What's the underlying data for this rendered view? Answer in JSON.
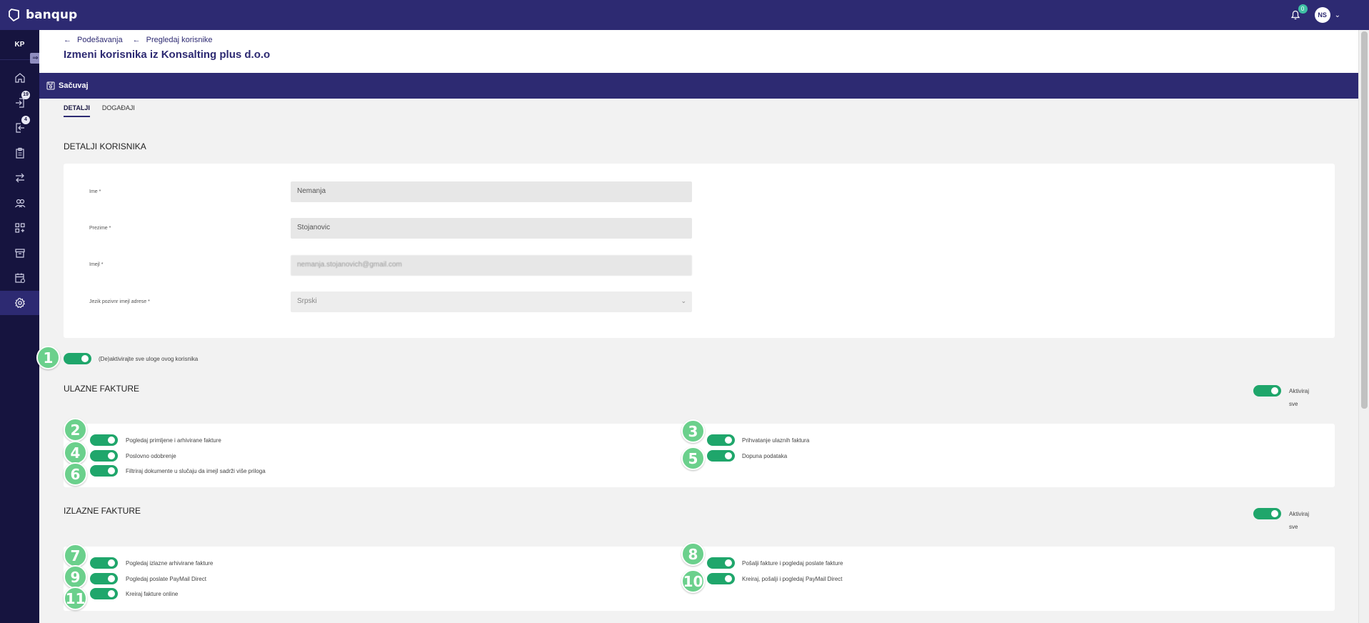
{
  "brand": "banqup",
  "topbar": {
    "notification_count": "0",
    "user_initials": "NS"
  },
  "sidebar": {
    "company": "KP",
    "items": [
      {
        "icon": "home-icon"
      },
      {
        "icon": "incoming-icon",
        "badge": "19"
      },
      {
        "icon": "outgoing-icon",
        "badge": "4"
      },
      {
        "icon": "clipboard-icon"
      },
      {
        "icon": "transfer-icon"
      },
      {
        "icon": "users-icon"
      },
      {
        "icon": "apps-icon"
      },
      {
        "icon": "archive-icon"
      },
      {
        "icon": "calendar-icon"
      },
      {
        "icon": "settings-icon",
        "active": true
      }
    ]
  },
  "breadcrumb": [
    "Podešavanja",
    "Pregledaj korisnike"
  ],
  "page_title": "Izmeni korisnika iz Konsalting plus d.o.o",
  "save_label": "Sačuvaj",
  "tabs": [
    "DETALJI",
    "DOGAĐAJI"
  ],
  "details": {
    "title": "DETALJI KORISNIKA",
    "first_name_label": "Ime *",
    "first_name": "Nemanja",
    "last_name_label": "Prezime *",
    "last_name": "Stojanovic",
    "email_label": "Imejl *",
    "email": "nemanja.stojanovich@gmail.com",
    "language_label": "Jezik pozivnr imejl adrese *",
    "language": "Srpski"
  },
  "master_toggle_label": "(De)aktivirajte sve uloge ovog korisnika",
  "incoming": {
    "title": "ULAZNE FAKTURE",
    "activate_all_1": "Aktiviraj",
    "activate_all_2": "sve",
    "left": [
      "Pogledaj primljene i arhivirane fakture",
      "Poslovno odobrenje",
      "Filtriraj dokumente u slučaju da imejl sadrži više priloga"
    ],
    "right": [
      "Prihvatanje ulaznih faktura",
      "Dopuna podataka"
    ]
  },
  "outgoing": {
    "title": "IZLAZNE FAKTURE",
    "activate_all_1": "Aktiviraj",
    "activate_all_2": "sve",
    "left": [
      "Pogledaj izlazne arhivirane fakture",
      "Pogledaj poslate PayMail Direct",
      "Kreiraj fakture online"
    ],
    "right": [
      "Pošalji fakture i pogledaj poslate fakture",
      "Kreiraj, pošalji i pogledaj PayMail Direct"
    ]
  },
  "markers": [
    "1",
    "2",
    "3",
    "4",
    "5",
    "6",
    "7",
    "8",
    "9",
    "10",
    "11"
  ],
  "colors": {
    "brand": "#2d2a72",
    "sidebar": "#16143f",
    "toggle_on": "#1fa66b",
    "marker": "#6bd08c"
  }
}
